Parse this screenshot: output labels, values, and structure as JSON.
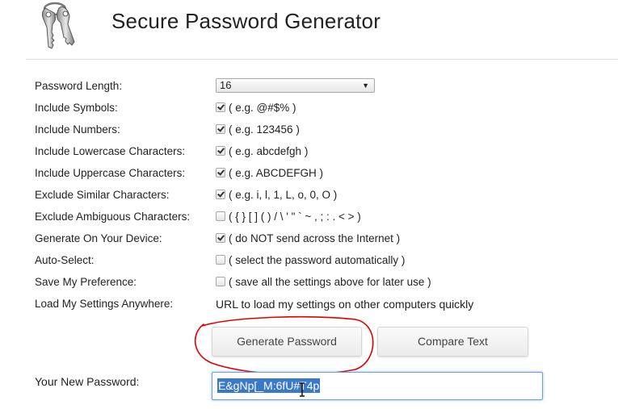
{
  "app": {
    "title": "Secure Password Generator",
    "logo_icon": "keys-icon"
  },
  "settings": {
    "password_length": {
      "label": "Password Length:",
      "value": "16"
    },
    "include_symbols": {
      "label": "Include Symbols:",
      "checked": true,
      "hint": "( e.g. @#$% )"
    },
    "include_numbers": {
      "label": "Include Numbers:",
      "checked": true,
      "hint": "( e.g. 123456 )"
    },
    "include_lowercase": {
      "label": "Include Lowercase Characters:",
      "checked": true,
      "hint": "( e.g. abcdefgh )"
    },
    "include_uppercase": {
      "label": "Include Uppercase Characters:",
      "checked": true,
      "hint": "( e.g. ABCDEFGH )"
    },
    "exclude_similar": {
      "label": "Exclude Similar Characters:",
      "checked": true,
      "hint": "( e.g. i, l, 1, L, o, 0, O )"
    },
    "exclude_ambiguous": {
      "label": "Exclude Ambiguous Characters:",
      "checked": false,
      "hint": "( { } [ ] ( ) / \\ ' \" ` ~ , ; : . < > )"
    },
    "generate_on_device": {
      "label": "Generate On Your Device:",
      "checked": true,
      "hint": "( do NOT send across the Internet )"
    },
    "auto_select": {
      "label": "Auto-Select:",
      "checked": false,
      "hint": "( select the password automatically )"
    },
    "save_preference": {
      "label": "Save My Preference:",
      "checked": false,
      "hint": "( save all the settings above for later use )"
    },
    "load_anywhere": {
      "label": "Load My Settings Anywhere:",
      "link_text": "URL to load my settings on other computers quickly"
    }
  },
  "actions": {
    "generate_label": "Generate Password",
    "compare_label": "Compare Text"
  },
  "output": {
    "label": "Your New Password:",
    "password": "E&gNp[_M:6fU#T4p"
  },
  "colors": {
    "selection": "#3a79c9",
    "annotation": "#e00000",
    "focus_border": "#6aa1d8"
  }
}
